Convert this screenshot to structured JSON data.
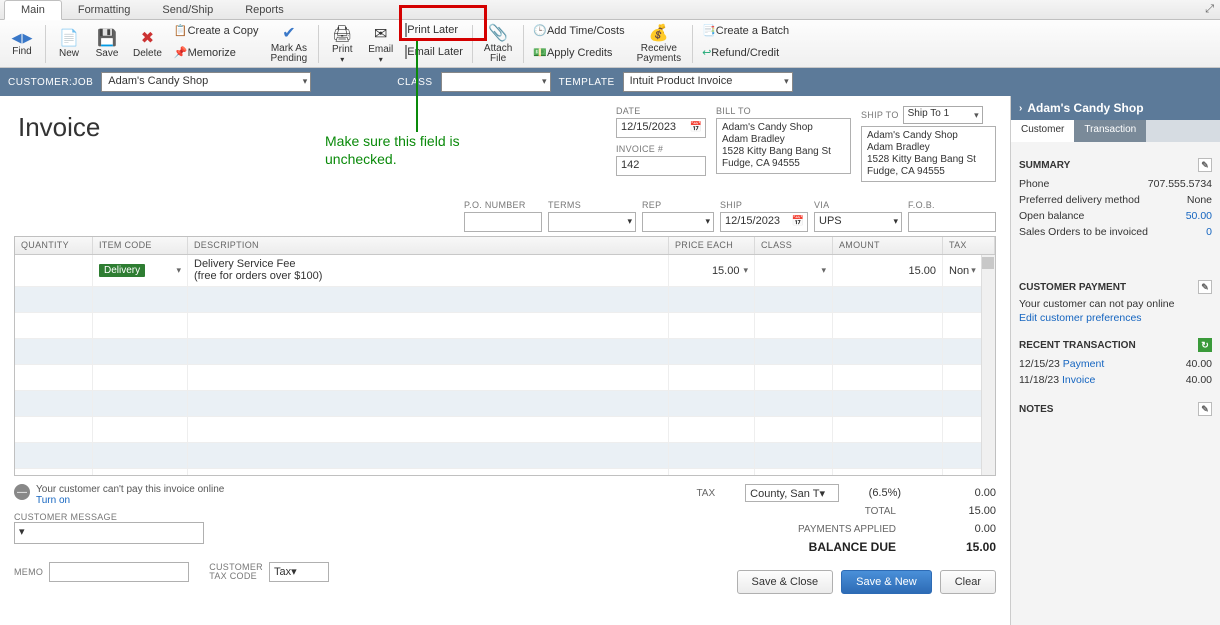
{
  "menu": {
    "tabs": [
      "Main",
      "Formatting",
      "Send/Ship",
      "Reports"
    ],
    "active": 0
  },
  "toolbar": {
    "find": "Find",
    "new": "New",
    "save": "Save",
    "delete": "Delete",
    "create_copy": "Create a Copy",
    "memorize": "Memorize",
    "mark_pending": "Mark As\nPending",
    "print": "Print",
    "email": "Email",
    "print_later": "Print Later",
    "email_later": "Email Later",
    "attach_file": "Attach\nFile",
    "add_time": "Add Time/Costs",
    "apply_credits": "Apply Credits",
    "receive_payments": "Receive\nPayments",
    "create_batch": "Create a Batch",
    "refund_credit": "Refund/Credit"
  },
  "annotation": {
    "text": "Make sure this field is\nunchecked."
  },
  "selectors": {
    "customer_lbl": "CUSTOMER:JOB",
    "customer_val": "Adam's Candy Shop",
    "class_lbl": "CLASS",
    "class_val": "",
    "template_lbl": "TEMPLATE",
    "template_val": "Intuit Product Invoice"
  },
  "title": "Invoice",
  "header": {
    "date_lbl": "DATE",
    "date_val": "12/15/2023",
    "invno_lbl": "INVOICE #",
    "invno_val": "142",
    "billto_lbl": "BILL TO",
    "billto": "Adam's Candy Shop\nAdam Bradley\n1528 Kitty Bang Bang St\nFudge, CA 94555",
    "shipto_lbl": "SHIP TO",
    "shipto_sel": "Ship To 1",
    "shipto": "Adam's Candy Shop\nAdam Bradley\n1528 Kitty Bang Bang St\nFudge, CA 94555"
  },
  "subhdr": {
    "po_lbl": "P.O. NUMBER",
    "po_val": "",
    "terms_lbl": "TERMS",
    "terms_val": "",
    "rep_lbl": "REP",
    "rep_val": "",
    "ship_lbl": "SHIP",
    "ship_val": "12/15/2023",
    "via_lbl": "VIA",
    "via_val": "UPS",
    "fob_lbl": "F.O.B.",
    "fob_val": ""
  },
  "grid": {
    "cols": {
      "qty": "QUANTITY",
      "item": "ITEM CODE",
      "desc": "DESCRIPTION",
      "price": "PRICE EACH",
      "class": "CLASS",
      "amt": "AMOUNT",
      "tax": "TAX"
    },
    "rows": [
      {
        "qty": "",
        "item": "Delivery",
        "desc": "Delivery Service Fee\n(free for orders over $100)",
        "price": "15.00",
        "class": "",
        "amt": "15.00",
        "tax": "Non"
      }
    ]
  },
  "payonline": {
    "msg": "Your customer can't pay this invoice online",
    "link": "Turn on"
  },
  "custmsg_lbl": "CUSTOMER MESSAGE",
  "memo_lbl": "MEMO",
  "custtax_lbl": "CUSTOMER\nTAX CODE",
  "custtax_val": "Tax",
  "totals": {
    "tax_lbl": "TAX",
    "tax_sel": "County, San T",
    "tax_rate": "(6.5%)",
    "tax_val": "0.00",
    "total_lbl": "TOTAL",
    "total_val": "15.00",
    "pay_lbl": "PAYMENTS APPLIED",
    "pay_val": "0.00",
    "bal_lbl": "BALANCE DUE",
    "bal_val": "15.00"
  },
  "actions": {
    "save_close": "Save & Close",
    "save_new": "Save & New",
    "clear": "Clear"
  },
  "rpanel": {
    "title": "Adam's Candy Shop",
    "tabs": [
      "Customer",
      "Transaction"
    ],
    "summary_title": "SUMMARY",
    "phone_lbl": "Phone",
    "phone_val": "707.555.5734",
    "deliv_lbl": "Preferred delivery method",
    "deliv_val": "None",
    "open_lbl": "Open balance",
    "open_val": "50.00",
    "so_lbl": "Sales Orders to be invoiced",
    "so_val": "0",
    "pay_title": "CUSTOMER PAYMENT",
    "pay_msg": "Your customer can not pay online",
    "pay_link": "Edit customer preferences",
    "recent_title": "RECENT TRANSACTION",
    "recent": [
      {
        "date": "12/15/23",
        "type": "Payment",
        "amt": "40.00"
      },
      {
        "date": "11/18/23",
        "type": "Invoice",
        "amt": "40.00"
      }
    ],
    "notes_title": "NOTES"
  }
}
